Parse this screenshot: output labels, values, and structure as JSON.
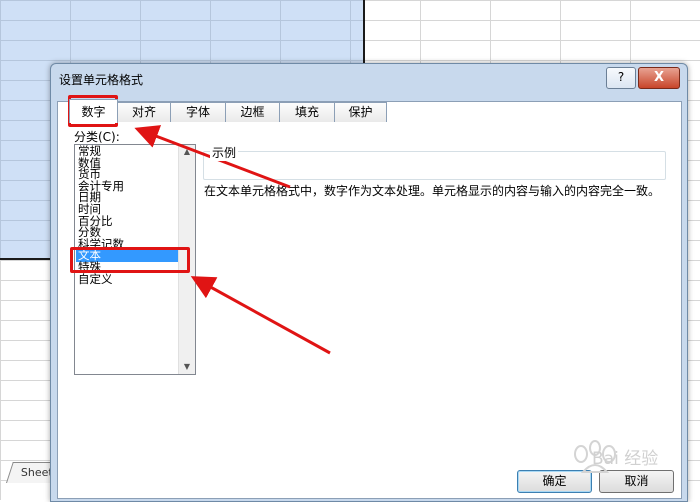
{
  "sheet": {
    "tab_label": "Sheet"
  },
  "dialog": {
    "title": "设置单元格格式",
    "help_label": "?",
    "close_label": "X",
    "tabs": [
      {
        "label": "数字",
        "active": true
      },
      {
        "label": "对齐"
      },
      {
        "label": "字体"
      },
      {
        "label": "边框"
      },
      {
        "label": "填充"
      },
      {
        "label": "保护"
      }
    ],
    "category_label": "分类(C):",
    "categories": [
      "常规",
      "数值",
      "货币",
      "会计专用",
      "日期",
      "时间",
      "百分比",
      "分数",
      "科学记数",
      "文本",
      "特殊",
      "自定义"
    ],
    "selected_category": "文本",
    "sample_label": "示例",
    "description": "在文本单元格格式中，数字作为文本处理。单元格显示的内容与输入的内容完全一致。",
    "ok_label": "确定",
    "cancel_label": "取消"
  },
  "annotations": {
    "color": "#e01414"
  },
  "watermark": {
    "text": "Bai 经验"
  }
}
